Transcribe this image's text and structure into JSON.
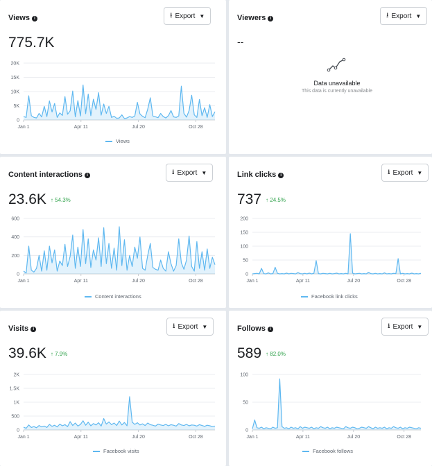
{
  "colors": {
    "series": "#5fb8f0",
    "grid": "#e4e6eb",
    "positive": "#31a24c"
  },
  "export_label": "Export",
  "cards": [
    {
      "title": "Views",
      "value": "775.7K",
      "change": "",
      "legend": "Views",
      "chart_data": {
        "type": "area",
        "series": [
          {
            "name": "Views",
            "values": [
              1200,
              900,
              8500,
              1500,
              900,
              700,
              2300,
              1100,
              4800,
              1200,
              6700,
              2800,
              5800,
              900,
              2500,
              1600,
              8200,
              2000,
              3200,
              10200,
              1100,
              6800,
              1400,
              12300,
              2200,
              9100,
              1500,
              7300,
              3700,
              9600,
              1700,
              5600,
              2300,
              4800,
              900,
              1300,
              600,
              700,
              1800,
              500,
              700,
              1200,
              900,
              1400,
              6200,
              2100,
              1300,
              800,
              3800,
              7800,
              1400,
              1100,
              800,
              2300,
              1200,
              700,
              1500,
              3300,
              1100,
              900,
              1400,
              11900,
              2300,
              1000,
              3300,
              8700,
              1800,
              900,
              7200,
              1500,
              4300,
              900,
              5400,
              1200,
              2900
            ]
          }
        ],
        "x_ticks": [
          "Jan 1",
          "Apr 11",
          "Jul 20",
          "Oct 28"
        ],
        "x_tick_positions": [
          0,
          0.3,
          0.6,
          0.9
        ],
        "y_ticks": [
          "0",
          "5K",
          "10K",
          "15K",
          "20K"
        ],
        "ylim": [
          0,
          20000
        ]
      }
    },
    {
      "title": "Viewers",
      "value": "--",
      "change": "",
      "legend": "",
      "unavailable": {
        "title": "Data unavailable",
        "subtitle": "This data is currently unavailable"
      },
      "chart_data": null
    },
    {
      "title": "Content interactions",
      "value": "23.6K",
      "change": "↑ 54.3%",
      "legend": "Content interactions",
      "chart_data": {
        "type": "area",
        "series": [
          {
            "name": "Content interactions",
            "values": [
              30,
              10,
              300,
              40,
              20,
              60,
              200,
              30,
              250,
              40,
              300,
              120,
              260,
              30,
              140,
              90,
              320,
              80,
              190,
              420,
              60,
              290,
              80,
              480,
              110,
              380,
              70,
              260,
              150,
              390,
              80,
              500,
              110,
              330,
              60,
              280,
              40,
              510,
              90,
              370,
              40,
              200,
              80,
              290,
              170,
              400,
              60,
              40,
              200,
              330,
              70,
              50,
              40,
              150,
              60,
              30,
              240,
              110,
              30,
              90,
              380,
              120,
              50,
              150,
              410,
              80,
              30,
              350,
              60,
              240,
              40,
              270,
              60,
              180,
              100
            ]
          }
        ],
        "x_ticks": [
          "Jan 1",
          "Apr 11",
          "Jul 20",
          "Oct 28"
        ],
        "x_tick_positions": [
          0,
          0.3,
          0.6,
          0.9
        ],
        "y_ticks": [
          "0",
          "200",
          "400",
          "600"
        ],
        "ylim": [
          0,
          600
        ]
      }
    },
    {
      "title": "Link clicks",
      "value": "737",
      "change": "↑ 24.5%",
      "legend": "Facebook link clicks",
      "chart_data": {
        "type": "area",
        "series": [
          {
            "name": "Facebook link clicks",
            "values": [
              0,
              1,
              2,
              0,
              20,
              1,
              0,
              4,
              0,
              1,
              24,
              2,
              0,
              1,
              0,
              3,
              0,
              2,
              1,
              0,
              5,
              1,
              0,
              2,
              0,
              3,
              0,
              2,
              48,
              1,
              0,
              2,
              1,
              0,
              2,
              0,
              1,
              3,
              0,
              1,
              0,
              2,
              0,
              145,
              3,
              0,
              1,
              2,
              0,
              1,
              0,
              6,
              1,
              0,
              2,
              0,
              1,
              0,
              4,
              0,
              1,
              0,
              2,
              1,
              55,
              0,
              2,
              0,
              1,
              0,
              3,
              0,
              1,
              0,
              2
            ]
          }
        ],
        "x_ticks": [
          "Jan 1",
          "Apr 11",
          "Jul 20",
          "Oct 28"
        ],
        "x_tick_positions": [
          0,
          0.3,
          0.6,
          0.9
        ],
        "y_ticks": [
          "0",
          "50",
          "100",
          "150",
          "200"
        ],
        "ylim": [
          0,
          200
        ]
      }
    },
    {
      "title": "Visits",
      "value": "39.6K",
      "change": "↑ 7.9%",
      "legend": "Facebook visits",
      "chart_data": {
        "type": "area",
        "series": [
          {
            "name": "Facebook visits",
            "values": [
              100,
              60,
              180,
              90,
              120,
              80,
              160,
              110,
              140,
              90,
              200,
              130,
              170,
              110,
              210,
              150,
              190,
              120,
              300,
              160,
              250,
              140,
              200,
              330,
              170,
              280,
              150,
              230,
              180,
              260,
              140,
              410,
              210,
              290,
              190,
              250,
              160,
              320,
              180,
              270,
              150,
              1200,
              280,
              200,
              260,
              180,
              220,
              160,
              250,
              190,
              170,
              140,
              210,
              180,
              160,
              200,
              150,
              190,
              170,
              140,
              230,
              180,
              160,
              200,
              150,
              180,
              170,
              140,
              190,
              160,
              130,
              170,
              150,
              120,
              140
            ]
          }
        ],
        "x_ticks": [
          "Jan 1",
          "Apr 11",
          "Jul 20",
          "Oct 28"
        ],
        "x_tick_positions": [
          0,
          0.3,
          0.6,
          0.9
        ],
        "y_ticks": [
          "0",
          "500",
          "1K",
          "1.5K",
          "2K"
        ],
        "ylim": [
          0,
          2000
        ]
      }
    },
    {
      "title": "Follows",
      "value": "589",
      "change": "↑ 82.0%",
      "legend": "Facebook follows",
      "chart_data": {
        "type": "area",
        "series": [
          {
            "name": "Facebook follows",
            "values": [
              2,
              18,
              4,
              3,
              5,
              2,
              4,
              3,
              2,
              5,
              3,
              4,
              92,
              6,
              3,
              4,
              2,
              5,
              3,
              4,
              2,
              6,
              3,
              5,
              4,
              3,
              5,
              2,
              4,
              3,
              6,
              4,
              3,
              5,
              2,
              4,
              3,
              5,
              4,
              3,
              2,
              6,
              4,
              3,
              5,
              4,
              2,
              3,
              5,
              4,
              3,
              6,
              4,
              2,
              5,
              3,
              4,
              3,
              5,
              2,
              4,
              3,
              6,
              4,
              3,
              5,
              2,
              4,
              3,
              5,
              4,
              3,
              2,
              4,
              3
            ]
          }
        ],
        "x_ticks": [
          "Jan 1",
          "Apr 11",
          "Jul 20",
          "Oct 28"
        ],
        "x_tick_positions": [
          0,
          0.3,
          0.6,
          0.9
        ],
        "y_ticks": [
          "0",
          "50",
          "100"
        ],
        "ylim": [
          0,
          100
        ]
      }
    }
  ]
}
